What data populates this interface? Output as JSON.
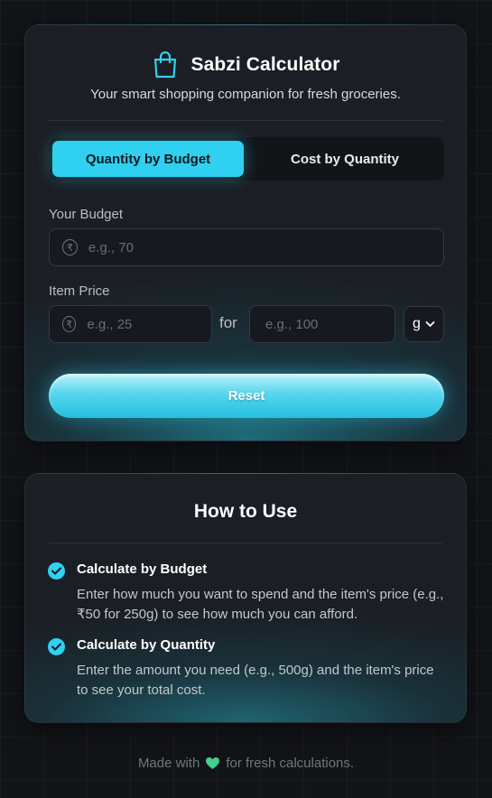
{
  "header": {
    "icon": "shopping-bag-icon",
    "title": "Sabzi Calculator",
    "subtitle": "Your smart shopping companion for fresh groceries."
  },
  "tabs": [
    {
      "label": "Quantity by Budget",
      "active": true
    },
    {
      "label": "Cost by Quantity",
      "active": false
    }
  ],
  "budget": {
    "label": "Your Budget",
    "placeholder": "e.g., 70",
    "value": "",
    "icon": "rupee-icon"
  },
  "item_price": {
    "label": "Item Price",
    "price_placeholder": "e.g., 25",
    "price_value": "",
    "for_label": "for",
    "quantity_placeholder": "e.g., 100",
    "quantity_value": "",
    "unit_selected": "g"
  },
  "reset_label": "Reset",
  "how_to_use": {
    "title": "How to Use",
    "items": [
      {
        "heading": "Calculate by Budget",
        "description": "Enter how much you want to spend and the item's price (e.g., ₹50 for 250g) to see how much you can afford."
      },
      {
        "heading": "Calculate by Quantity",
        "description": "Enter the amount you need (e.g., 500g) and the item's price to see your total cost."
      }
    ]
  },
  "footer": {
    "prefix": "Made with",
    "icon": "heart-icon",
    "suffix": "for fresh calculations."
  },
  "colors": {
    "accent": "#30d0f0",
    "background": "#121418",
    "card": "#1b1e24",
    "heart": "#3ecf8e"
  }
}
